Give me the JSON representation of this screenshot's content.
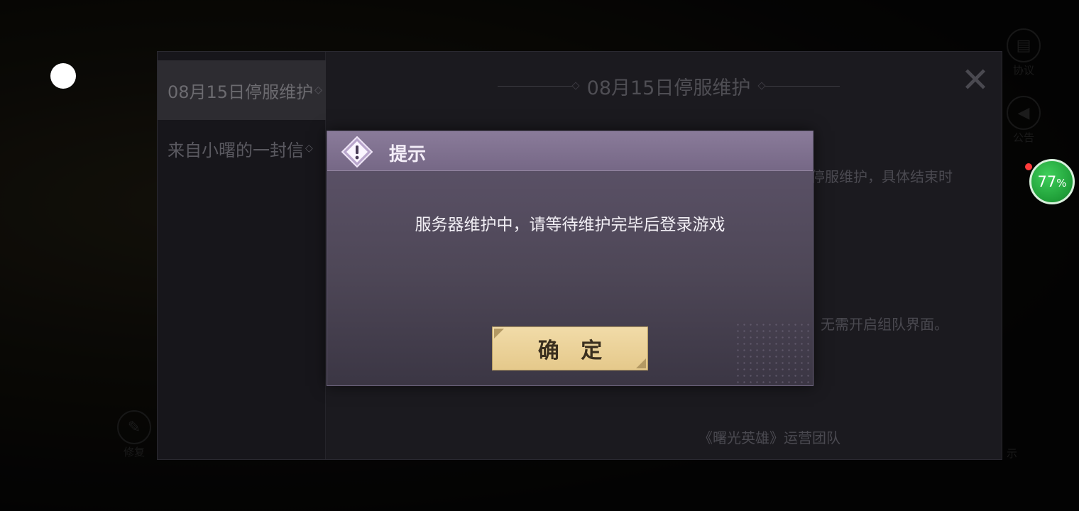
{
  "background": {
    "side_icons": [
      {
        "label": "协议",
        "icon": "document-icon"
      },
      {
        "label": "公告",
        "icon": "megaphone-icon"
      }
    ],
    "repair_label": "修复",
    "hint_label": "示"
  },
  "notice": {
    "tabs": [
      {
        "label": "08月15日停服维护",
        "active": true
      },
      {
        "label": "来自小曙的一封信",
        "active": false
      }
    ],
    "title": "08月15日停服维护",
    "text_line_1": "停服维护，具体结束时",
    "text_line_2": "无需开启组队界面。",
    "signature": "《曙光英雄》运营团队"
  },
  "modal": {
    "title": "提示",
    "message": "服务器维护中，请等待维护完毕后登录游戏",
    "confirm_label": "确 定"
  },
  "battery_widget": {
    "value": "77",
    "unit": "%"
  },
  "colors": {
    "modal_header": "#766886",
    "confirm_button": "#e5c98b",
    "battery_green": "#1f9e38"
  }
}
